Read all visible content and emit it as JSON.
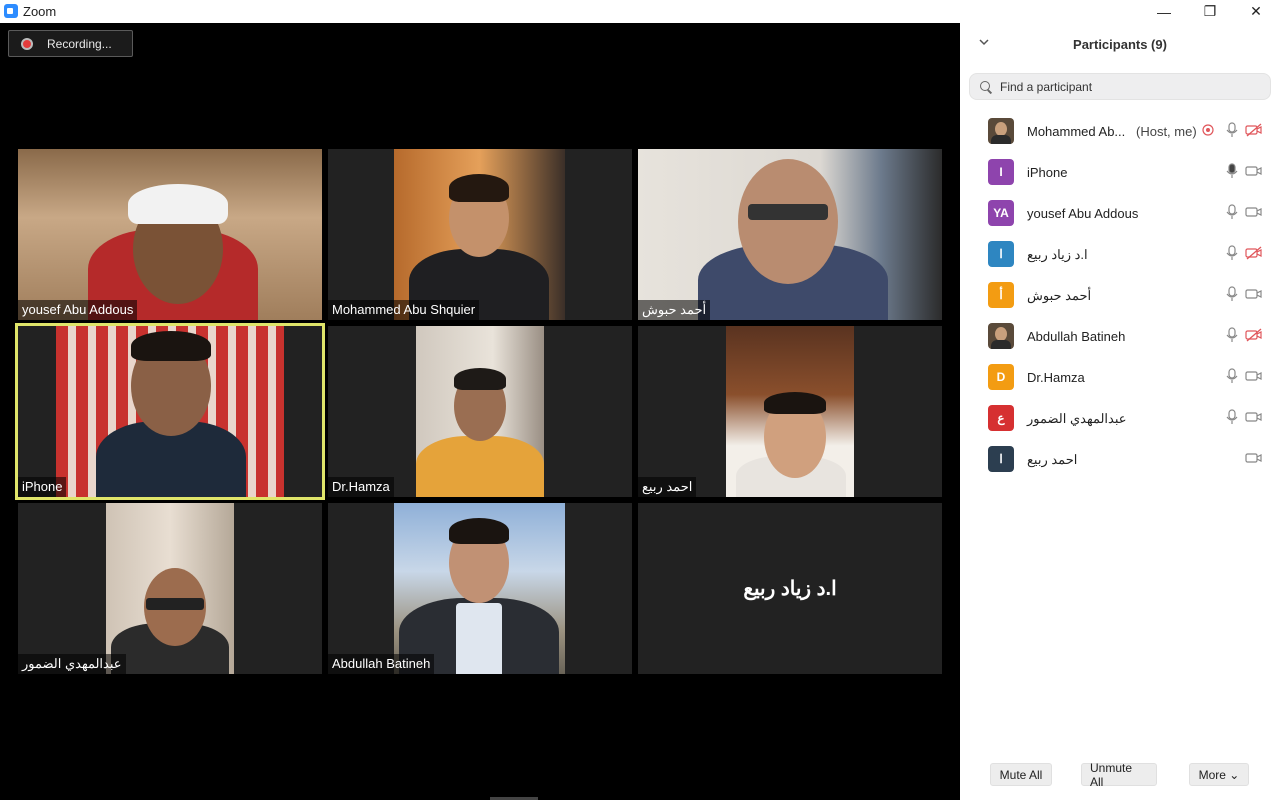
{
  "window": {
    "title": "Zoom",
    "minimize": "—",
    "restore": "❐",
    "close": "✕"
  },
  "meeting": {
    "recording_label": "Recording...",
    "tiles": [
      {
        "name": "yousef Abu Addous"
      },
      {
        "name": "Mohammed Abu Shquier"
      },
      {
        "name": "أحمد حبوش"
      },
      {
        "name": "iPhone",
        "active": true
      },
      {
        "name": "Dr.Hamza"
      },
      {
        "name": "احمد ربيع"
      },
      {
        "name": "عبدالمهدي الضمور"
      },
      {
        "name": "Abdullah Batineh"
      },
      {
        "name": "ا.د زياد ربيع",
        "video_off": true
      }
    ]
  },
  "panel": {
    "title": "Participants (9)",
    "search_placeholder": "Find a participant",
    "participants": [
      {
        "name": "Mohammed Ab...",
        "tag": "(Host, me)",
        "avatar": "photo",
        "mic": "on",
        "video": "off",
        "recording": true
      },
      {
        "name": "iPhone",
        "initials": "I",
        "color": "#8e44ad",
        "mic": "active",
        "video": "on"
      },
      {
        "name": "yousef Abu Addous",
        "initials": "YA",
        "color": "#8e44ad",
        "mic": "on",
        "video": "on"
      },
      {
        "name": "ا.د زياد ربيع",
        "initials": "ا",
        "color": "#2e86c1",
        "mic": "on",
        "video": "off"
      },
      {
        "name": "أحمد حبوش",
        "initials": "أ",
        "color": "#f39c12",
        "mic": "on",
        "video": "on"
      },
      {
        "name": "Abdullah Batineh",
        "avatar": "photo",
        "mic": "on",
        "video": "off"
      },
      {
        "name": "Dr.Hamza",
        "initials": "D",
        "color": "#f39c12",
        "mic": "on",
        "video": "on"
      },
      {
        "name": "عبدالمهدي الضمور",
        "initials": "ع",
        "color": "#d63031",
        "mic": "on",
        "video": "on"
      },
      {
        "name": "احمد ربيع",
        "initials": "ا",
        "color": "#2c3e50",
        "mic": "none",
        "video": "on"
      }
    ],
    "buttons": {
      "mute_all": "Mute All",
      "unmute_all": "Unmute All",
      "more": "More ⌄"
    }
  }
}
